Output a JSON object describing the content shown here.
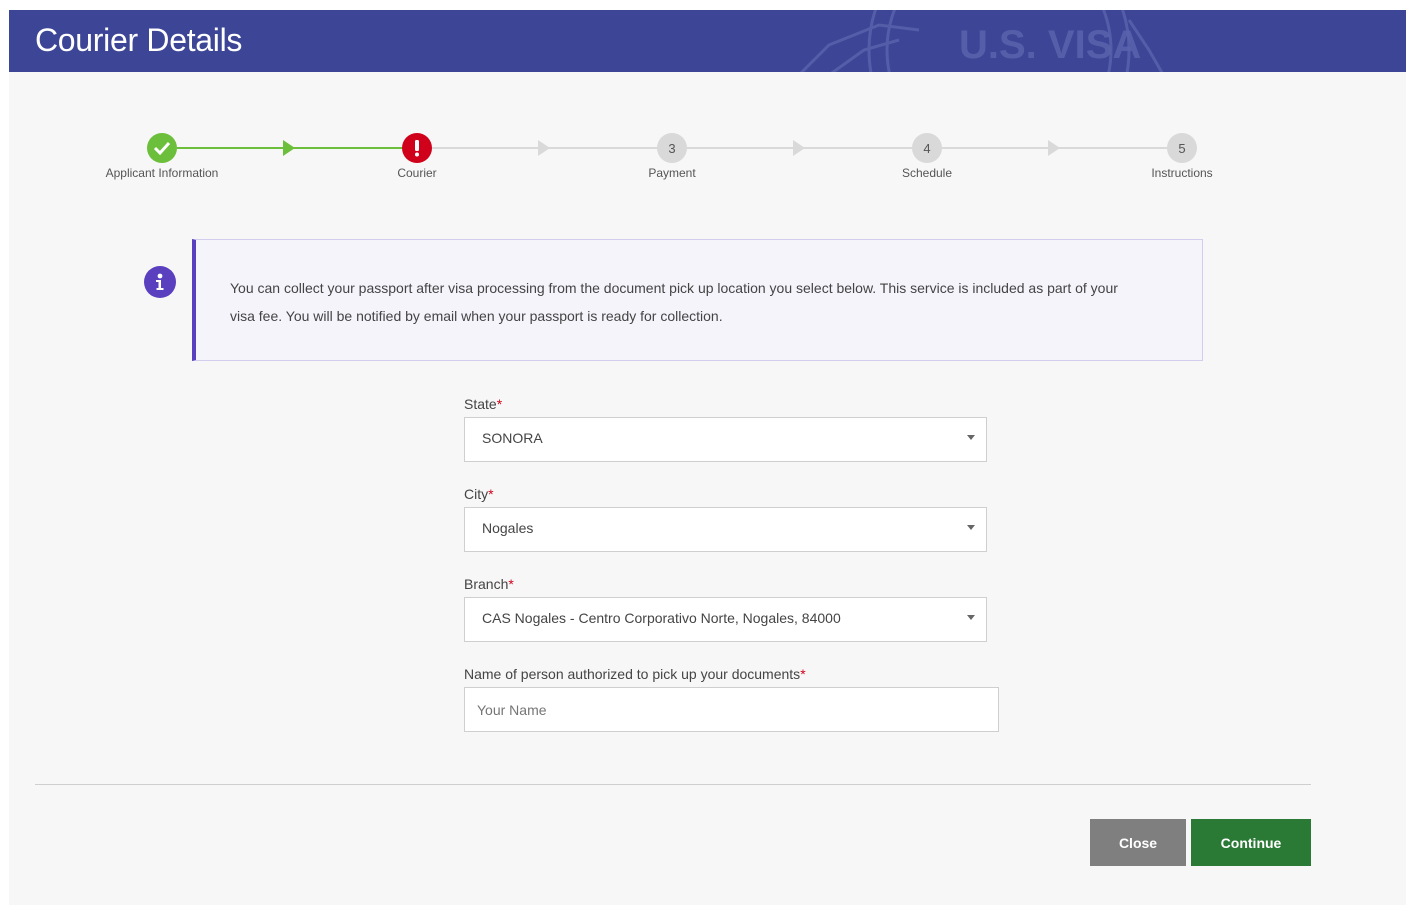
{
  "header": {
    "title": "Courier Details",
    "seal_text": "U.S. VISA"
  },
  "stepper": {
    "steps": [
      {
        "number": "",
        "label": "Applicant Information",
        "status": "complete"
      },
      {
        "number": "",
        "label": "Courier",
        "status": "current"
      },
      {
        "number": "3",
        "label": "Payment",
        "status": "pending"
      },
      {
        "number": "4",
        "label": "Schedule",
        "status": "pending"
      },
      {
        "number": "5",
        "label": "Instructions",
        "status": "pending"
      }
    ]
  },
  "info": {
    "text": "You can collect your passport after visa processing from the document pick up location you select below. This service is included as part of your visa fee. You will be notified by email when your passport is ready for collection."
  },
  "form": {
    "state": {
      "label": "State",
      "required_mark": "*",
      "value": "SONORA"
    },
    "city": {
      "label": "City",
      "required_mark": "*",
      "value": "Nogales"
    },
    "branch": {
      "label": "Branch",
      "required_mark": "*",
      "value": "CAS Nogales - Centro Corporativo Norte, Nogales, 84000"
    },
    "authorized_name": {
      "label": "Name of person authorized to pick up your documents",
      "required_mark": "*",
      "placeholder": "Your Name",
      "value": ""
    }
  },
  "buttons": {
    "close": "Close",
    "continue": "Continue"
  },
  "colors": {
    "header": "#3c4596",
    "complete": "#6bbf3a",
    "current": "#d0021b",
    "info_accent": "#5a3fbf",
    "continue": "#2a7a36",
    "close": "#7f7f7f"
  }
}
